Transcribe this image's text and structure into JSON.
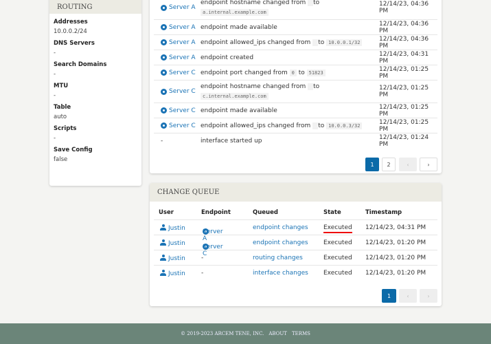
{
  "routing": {
    "title": "ROUTING",
    "fields": [
      {
        "label": "Addresses",
        "value": "10.0.0.2/24"
      },
      {
        "label": "DNS Servers",
        "value": "-"
      },
      {
        "label": "Search Domains",
        "value": "-"
      },
      {
        "label": "MTU",
        "value": "-"
      },
      {
        "label": "Table",
        "value": "auto"
      },
      {
        "label": "Scripts",
        "value": "-"
      },
      {
        "label": "Save Config",
        "value": "false"
      }
    ]
  },
  "events": {
    "rows": [
      {
        "endpoint": "Server A",
        "text": "endpoint hostname changed from",
        "to": "to",
        "from_val": "",
        "to_val": "a.internal.example.com",
        "time": "12/14/23, 04:36 PM"
      },
      {
        "endpoint": "Server A",
        "text": "endpoint made available",
        "time": "12/14/23, 04:36 PM"
      },
      {
        "endpoint": "Server A",
        "text": "endpoint allowed_ips changed from",
        "to": "to",
        "from_val": "",
        "to_val": "10.0.0.1/32",
        "time": "12/14/23, 04:36 PM"
      },
      {
        "endpoint": "Server A",
        "text": "endpoint created",
        "time": "12/14/23, 04:31 PM"
      },
      {
        "endpoint": "Server C",
        "text": "endpoint port changed from",
        "to": "to",
        "from_val": "0",
        "to_val": "51823",
        "time": "12/14/23, 01:25 PM"
      },
      {
        "endpoint": "Server C",
        "text": "endpoint hostname changed from",
        "to": "to",
        "from_val": "",
        "to_val": "c.internal.example.com",
        "time": "12/14/23, 01:25 PM"
      },
      {
        "endpoint": "Server C",
        "text": "endpoint made available",
        "time": "12/14/23, 01:25 PM"
      },
      {
        "endpoint": "Server C",
        "text": "endpoint allowed_ips changed from",
        "to": "to",
        "from_val": "",
        "to_val": "10.0.0.3/32",
        "time": "12/14/23, 01:25 PM"
      },
      {
        "endpoint": "-",
        "text": "interface started up",
        "time": "12/14/23, 01:24 PM"
      }
    ],
    "pagination": {
      "pages": [
        "1",
        "2"
      ],
      "current": "1",
      "prev": "‹",
      "next": "›"
    }
  },
  "queue": {
    "title": "CHANGE QUEUE",
    "headers": [
      "User",
      "Endpoint",
      "Queued",
      "State",
      "Timestamp"
    ],
    "rows": [
      {
        "user": "Justin",
        "endpoint": "Server A",
        "queued": "endpoint changes",
        "state": "Executed",
        "time": "12/14/23, 04:31 PM"
      },
      {
        "user": "Justin",
        "endpoint": "Server C",
        "queued": "endpoint changes",
        "state": "Executed",
        "time": "12/14/23, 01:20 PM"
      },
      {
        "user": "Justin",
        "endpoint": "-",
        "queued": "routing changes",
        "state": "Executed",
        "time": "12/14/23, 01:20 PM"
      },
      {
        "user": "Justin",
        "endpoint": "-",
        "queued": "interface changes",
        "state": "Executed",
        "time": "12/14/23, 01:20 PM"
      }
    ],
    "pagination": {
      "pages": [
        "1"
      ],
      "current": "1",
      "prev": "‹",
      "next": "›"
    }
  },
  "footer": {
    "copyright": "© 2019-2023 ARCEM TENE, INC.",
    "about": "ABOUT",
    "terms": "TERMS"
  },
  "colors": {
    "accent": "#1a73b5",
    "active_page": "#0b6aa8",
    "footer": "#6b8579",
    "header": "#ecebe3"
  }
}
